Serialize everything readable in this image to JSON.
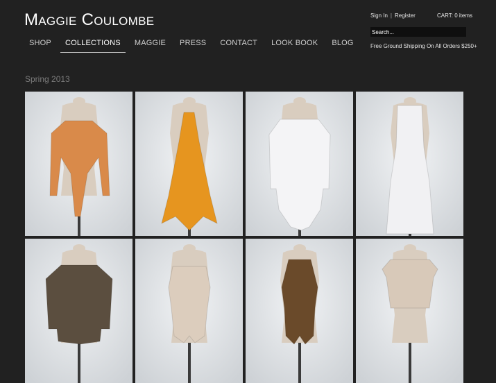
{
  "header": {
    "logo": "Maggie Coulombe",
    "account": {
      "sign_in": "Sign In",
      "separator": "|",
      "register": "Register"
    },
    "cart": "CART: 0 items",
    "search": {
      "placeholder": "Search..."
    },
    "shipping": "Free Ground Shipping On All Orders $250+"
  },
  "nav": {
    "items": [
      {
        "label": "SHOP",
        "active": false
      },
      {
        "label": "COLLECTIONS",
        "active": true
      },
      {
        "label": "MAGGIE",
        "active": false
      },
      {
        "label": "PRESS",
        "active": false
      },
      {
        "label": "CONTACT",
        "active": false
      },
      {
        "label": "LOOK BOOK",
        "active": false
      },
      {
        "label": "BLOG",
        "active": false
      }
    ]
  },
  "collection": {
    "title": "Spring 2013",
    "colors": {
      "background": "#212121",
      "tile_background": "#e9ecef",
      "mannequin": "#d9cdbf",
      "stand": "#3a3a3a"
    },
    "items": [
      {
        "garment": "orange-print-tie-jacket",
        "color": "#d98a4a"
      },
      {
        "garment": "orange-print-halter-dress",
        "color": "#e6951f"
      },
      {
        "garment": "white-draped-cardigan",
        "color": "#f4f4f6"
      },
      {
        "garment": "white-halter-gown",
        "color": "#f1f1f3"
      },
      {
        "garment": "brown-vneck-top",
        "color": "#5b4e3f"
      },
      {
        "garment": "nude-wrap-bodysuit",
        "color": "#dccdbd"
      },
      {
        "garment": "brown-halter-swimsuit",
        "color": "#6a4a2a"
      },
      {
        "garment": "nude-cap-sleeve-top",
        "color": "#d8c9b9"
      }
    ]
  }
}
